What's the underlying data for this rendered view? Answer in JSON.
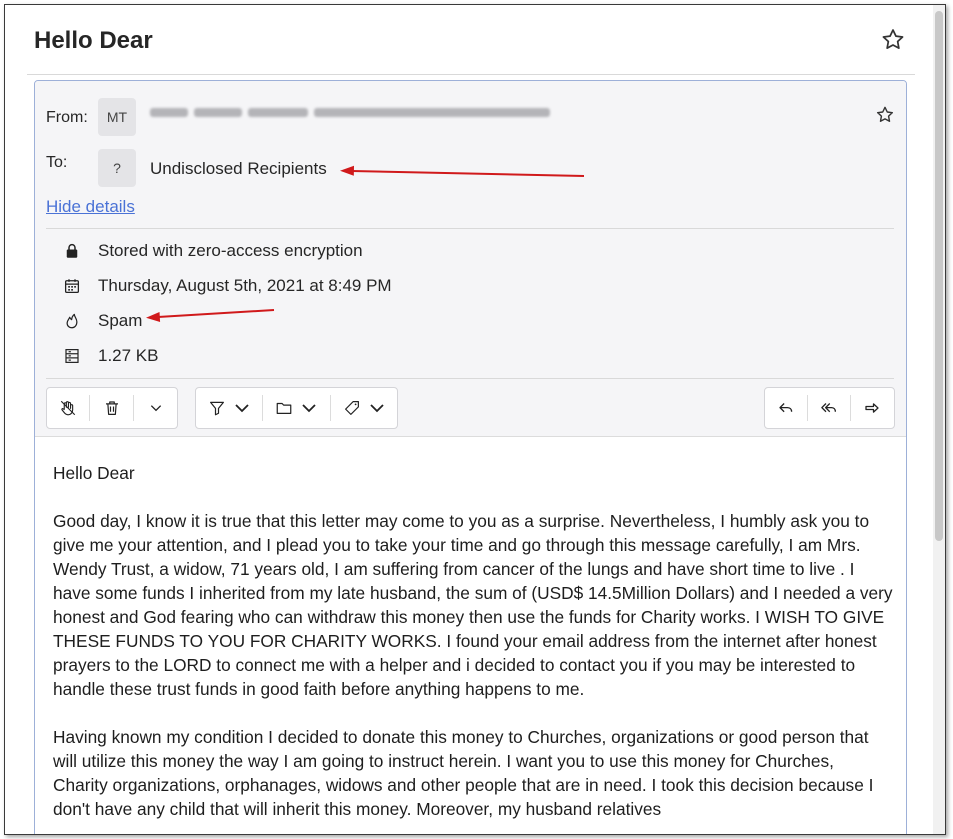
{
  "message": {
    "subject": "Hello Dear",
    "from_label": "From:",
    "from_initials": "MT",
    "to_label": "To:",
    "to_initials": "?",
    "recipients": "Undisclosed Recipients",
    "hide_details": "Hide details"
  },
  "details": {
    "encryption": "Stored with zero-access encryption",
    "date": "Thursday, August 5th, 2021 at 8:49 PM",
    "folder": "Spam",
    "size": "1.27 KB"
  },
  "body": {
    "p1": "Hello Dear",
    "p2": "Good day, I know it is true that this letter may come to you as a surprise. Nevertheless, I humbly ask you to give me your attention, and I plead you to take your time and go through this message carefully, I am Mrs. Wendy Trust, a widow, 71 years old, I am suffering from cancer of the lungs and have short time to live . I have some funds I inherited from my late husband, the sum of (USD$ 14.5Million Dollars) and I needed a very honest and God fearing who can withdraw this money then use the funds for Charity works. I WISH TO GIVE THESE FUNDS TO YOU FOR CHARITY WORKS. I found your email address from the internet after honest prayers to the LORD to connect me with a helper and i decided to contact you if you may be interested to handle these trust funds in good faith before anything happens to me.",
    "p3": "Having known my condition I decided to donate this money to Churches, organizations or good person that will utilize this money the way I am going to instruct herein. I want you to use this money for Churches, Charity organizations, orphanages, widows and other people that are in need. I took this decision because I don't have any child that will inherit this money. Moreover, my husband relatives"
  },
  "icons": {
    "star": "star-icon",
    "lock": "lock-icon",
    "calendar": "calendar-icon",
    "spam": "fire-icon",
    "size": "storage-icon",
    "not_spam": "hand-icon",
    "trash": "trash-icon",
    "filter": "filter-icon",
    "folder": "folder-icon",
    "label": "tag-icon",
    "reply": "reply-icon",
    "reply_all": "reply-all-icon",
    "forward": "forward-icon"
  },
  "colors": {
    "link": "#4a72d6",
    "annotation_arrow": "#d0191b",
    "header_bg": "#f5f5f7"
  }
}
